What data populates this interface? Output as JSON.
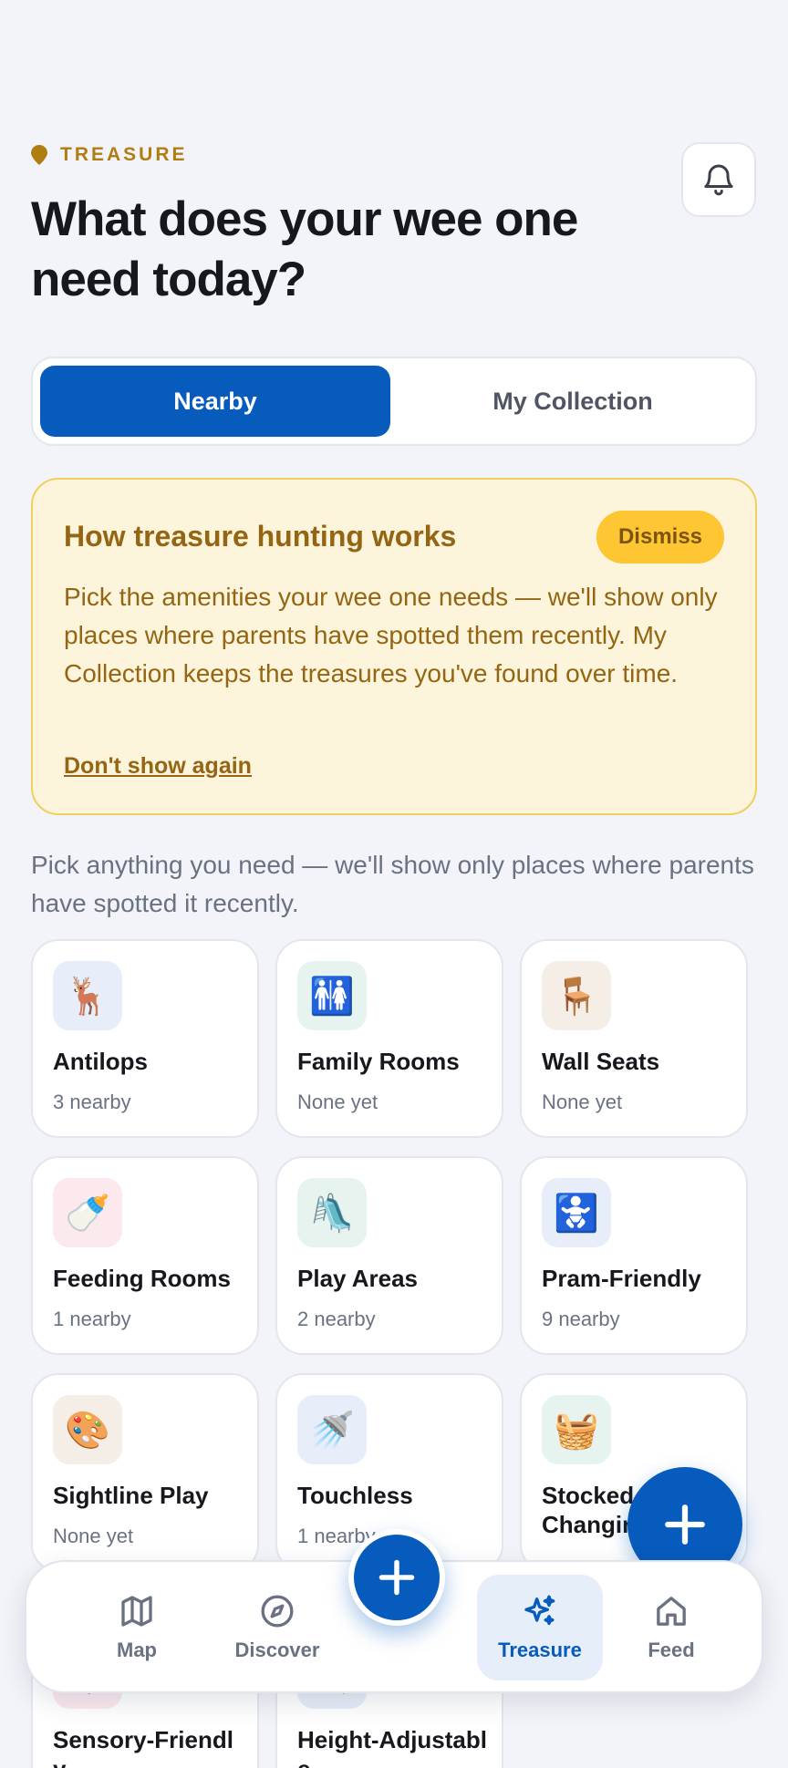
{
  "header": {
    "eyebrow": "TREASURE",
    "title": "What does your wee one need today?"
  },
  "tabs": [
    {
      "label": "Nearby",
      "active": true
    },
    {
      "label": "My Collection",
      "active": false
    }
  ],
  "info_card": {
    "title": "How treasure hunting works",
    "dismiss_label": "Dismiss",
    "body": "Pick the amenities your wee one needs — we'll show only places where parents have spotted them recently. My Collection keeps the treasures you've found over time.",
    "link_label": "Don't show again"
  },
  "hint": "Pick anything you need — we'll show only places where parents have spotted it recently.",
  "amenities": [
    {
      "icon": "🦌",
      "name": "Antilops",
      "count": "3 nearby",
      "bg": "#e7eef9"
    },
    {
      "icon": "🚻",
      "name": "Family Rooms",
      "count": "None yet",
      "bg": "#e6f3ef"
    },
    {
      "icon": "🪑",
      "name": "Wall Seats",
      "count": "None yet",
      "bg": "#f4eee7"
    },
    {
      "icon": "🍼",
      "name": "Feeding Rooms",
      "count": "1 nearby",
      "bg": "#fbe9ee"
    },
    {
      "icon": "🛝",
      "name": "Play Areas",
      "count": "2 nearby",
      "bg": "#e6f3ef"
    },
    {
      "icon": "🚼",
      "name": "Pram-Friendly",
      "count": "9 nearby",
      "bg": "#e7eef9"
    },
    {
      "icon": "🎨",
      "name": "Sightline Play",
      "count": "None yet",
      "bg": "#f4eee7"
    },
    {
      "icon": "🚿",
      "name": "Touchless",
      "count": "1 nearby",
      "bg": "#e7eef9"
    },
    {
      "icon": "🧺",
      "name": "Stocked Changing",
      "count": "",
      "bg": "#e6f3ef"
    },
    {
      "icon": "🧩",
      "name": "Sensory-Friendly",
      "count": "",
      "bg": "#fbe9ee"
    },
    {
      "icon": "📏",
      "name": "Height-Adjustable",
      "count": "",
      "bg": "#e7eef9"
    }
  ],
  "nav": {
    "items": [
      {
        "label": "Map",
        "icon": "map-icon"
      },
      {
        "label": "Discover",
        "icon": "compass-icon"
      },
      {
        "label": "Treasure",
        "icon": "sparkles-icon",
        "active": true
      },
      {
        "label": "Feed",
        "icon": "home-icon"
      }
    ]
  },
  "colors": {
    "primary": "#075bbc",
    "accent_gold": "#b07d12",
    "info_bg": "#fdf4dc",
    "dismiss_bg": "#fdc632"
  }
}
